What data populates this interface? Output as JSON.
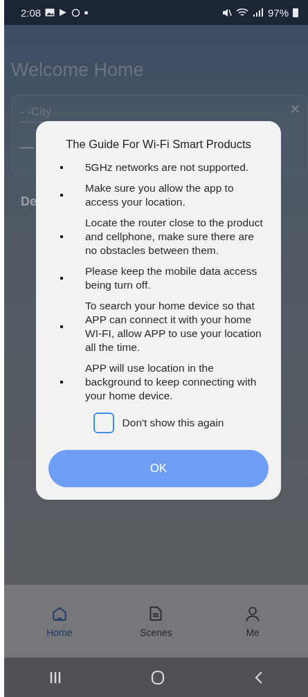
{
  "status_bar": {
    "time": "2:08",
    "battery": "97%"
  },
  "background": {
    "title": "Welcome Home",
    "city": "- -City",
    "temperature": "—",
    "section": "De",
    "close": "×"
  },
  "dialog": {
    "title": "The Guide For Wi-Fi Smart Products",
    "items": [
      "5GHz networks are not supported.",
      "Make sure you allow the app to access your location.",
      "Locate the router close to the product and cellphone, make sure there are no obstacles between them.",
      "Please keep the mobile data access being turn off.",
      "To search your home device so that APP can connect it with your home WI-FI, allow APP to use your location all the time.",
      "APP will use location in the background to keep connecting with your home device."
    ],
    "checkbox": {
      "label": "Don't show this again",
      "checked": false
    },
    "button": "OK"
  },
  "tabs": [
    {
      "label": "Home",
      "kind": "home",
      "selected": true
    },
    {
      "label": "Scenes",
      "kind": "scenes",
      "selected": false
    },
    {
      "label": "Me",
      "kind": "me",
      "selected": false
    }
  ]
}
